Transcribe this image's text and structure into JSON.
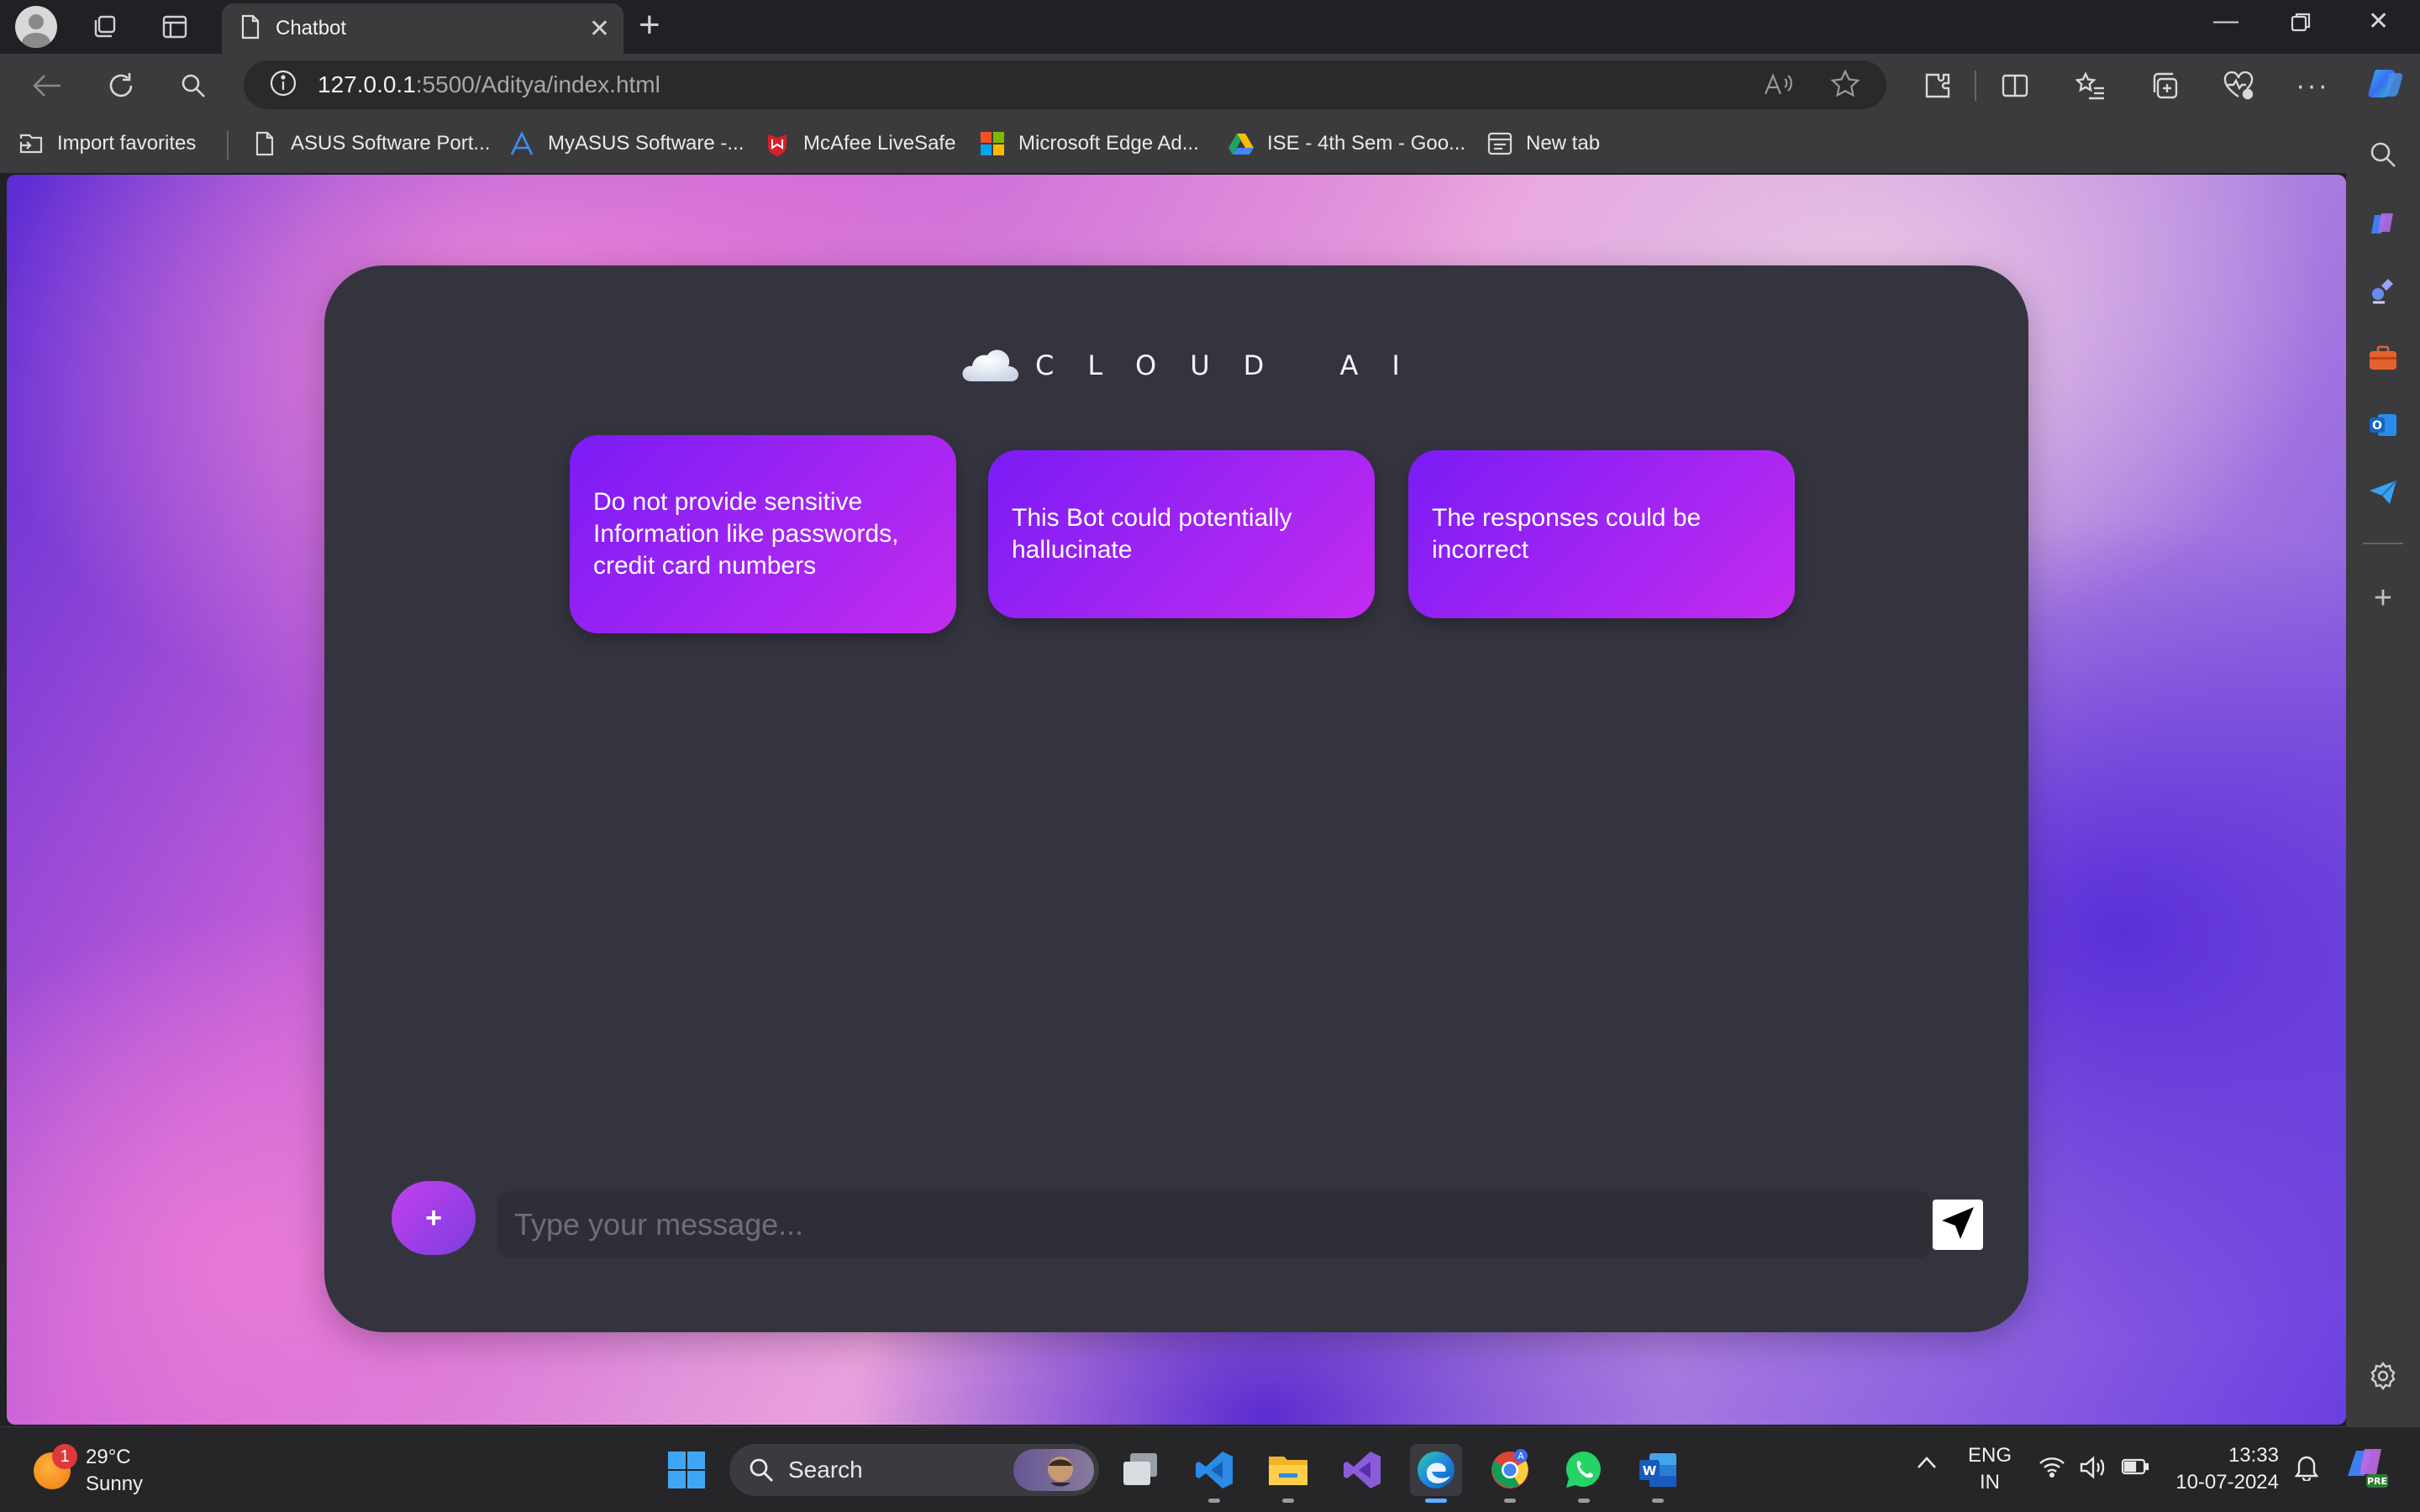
{
  "browser": {
    "tab_title": "Chatbot",
    "url_host": "127.0.0.1",
    "url_path": ":5500/Aditya/index.html"
  },
  "favorites": [
    {
      "label": "Import favorites",
      "icon": "import-icon"
    },
    {
      "label": "ASUS Software Port...",
      "icon": "page-icon"
    },
    {
      "label": "MyASUS Software -...",
      "icon": "myasus-icon"
    },
    {
      "label": "McAfee LiveSafe",
      "icon": "mcafee-icon"
    },
    {
      "label": "Microsoft Edge Ad...",
      "icon": "microsoft-icon"
    },
    {
      "label": "ISE - 4th Sem - Goo...",
      "icon": "google-drive-icon"
    },
    {
      "label": "New tab",
      "icon": "new-tab-icon"
    }
  ],
  "chat": {
    "brand": "CLOUD AI",
    "notices": [
      "Do not provide sensitive Information like passwords, credit card numbers",
      "This Bot could potentially hallucinate",
      "The responses could be incorrect"
    ],
    "input_placeholder": "Type your message...",
    "attach_label": "+"
  },
  "taskbar": {
    "weather_temp": "29°C",
    "weather_desc": "Sunny",
    "weather_badge": "1",
    "search_label": "Search",
    "lang_top": "ENG",
    "lang_bottom": "IN",
    "time": "13:33",
    "date": "10-07-2024"
  },
  "colors": {
    "card_bg": "#34343f",
    "notice_gradient_start": "#7a1cf5",
    "notice_gradient_end": "#c32cf0",
    "edge_accent": "#5ab0ff"
  }
}
